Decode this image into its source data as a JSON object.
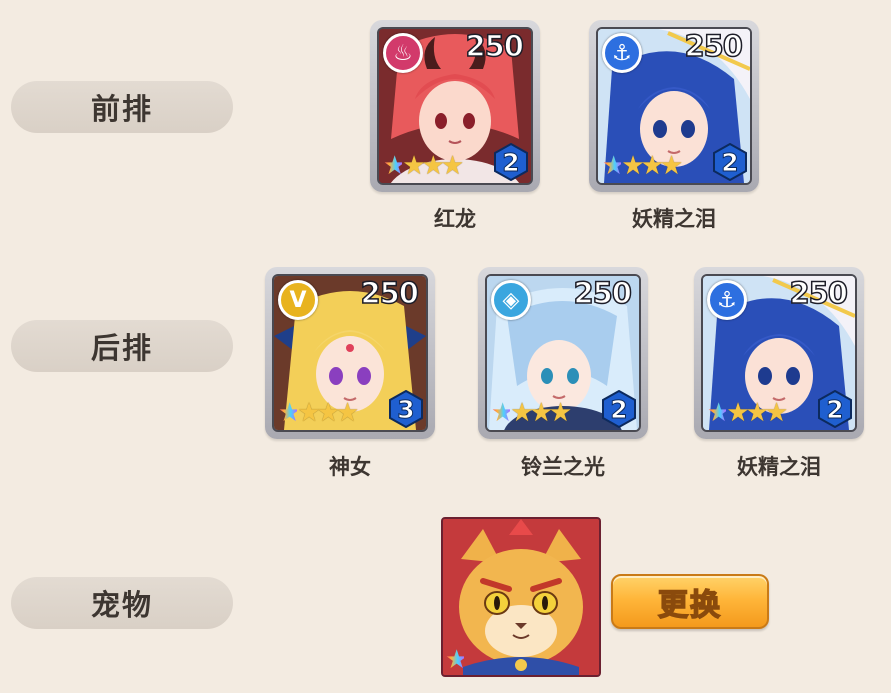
{
  "rows": {
    "front_label": "前排",
    "back_label": "后排",
    "pet_label": "宠物"
  },
  "front": [
    {
      "name": "红龙",
      "power": "250",
      "level": "2",
      "stars": 4,
      "faction": "flame-crest-icon",
      "faction_color": "#d23a6b"
    },
    {
      "name": "妖精之泪",
      "power": "250",
      "level": "2",
      "stars": 4,
      "faction": "anchor-icon",
      "faction_color": "#2d6fe0"
    }
  ],
  "back": [
    {
      "name": "神女",
      "power": "250",
      "level": "3",
      "stars": 4,
      "faction": "wing-crest-icon",
      "faction_color": "#e8b31e"
    },
    {
      "name": "铃兰之光",
      "power": "250",
      "level": "2",
      "stars": 4,
      "faction": "diamond-crest-icon",
      "faction_color": "#3aa6df"
    },
    {
      "name": "妖精之泪",
      "power": "250",
      "level": "2",
      "stars": 4,
      "faction": "anchor-icon",
      "faction_color": "#2d6fe0"
    }
  ],
  "pet": {
    "stars": 1,
    "swap_label": "更换"
  },
  "glyphs": {
    "star_rainbow": "★",
    "star_gold": "★★★",
    "anchor": "⚓",
    "flame": "♨",
    "wing": "V",
    "diamond": "◈"
  }
}
